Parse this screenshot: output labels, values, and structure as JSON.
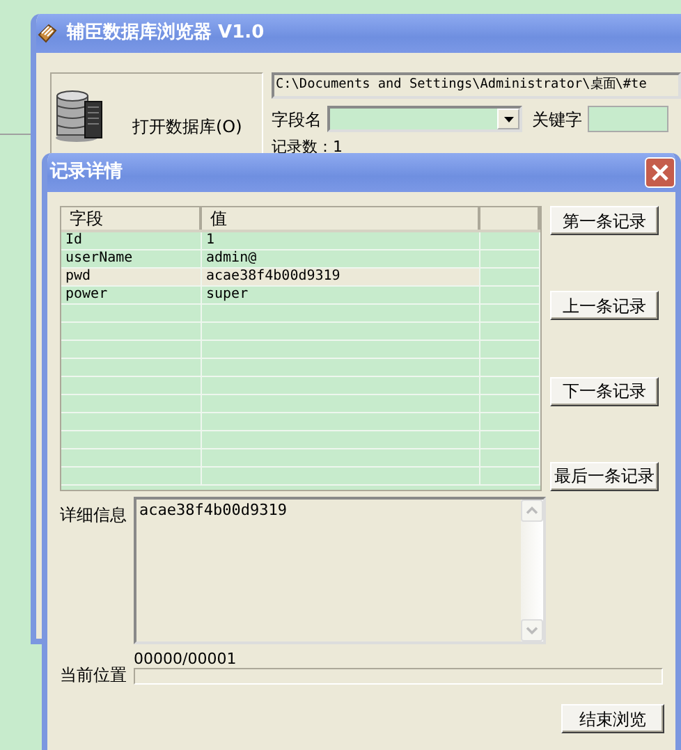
{
  "main_window": {
    "title": "辅臣数据库浏览器 V1.0",
    "open_button": "打开数据库(O)",
    "path": "C:\\Documents and Settings\\Administrator\\桌面\\#te",
    "field_label": "字段名",
    "keyword_label": "关键字",
    "record_count": "记录数：1"
  },
  "dialog": {
    "title": "记录详情",
    "table": {
      "columns": [
        "字段",
        "值"
      ],
      "rows": [
        {
          "field": "Id",
          "value": "1",
          "selected": false
        },
        {
          "field": "userName",
          "value": "admin@",
          "selected": false
        },
        {
          "field": "pwd",
          "value": "acae38f4b00d9319",
          "selected": true
        },
        {
          "field": "power",
          "value": "super",
          "selected": false
        }
      ]
    },
    "nav_buttons": [
      "第一条记录",
      "上一条记录",
      "下一条记录",
      "最后一条记录"
    ],
    "detail_label": "详细信息",
    "detail_text": "acae38f4b00d9319",
    "position_label": "当前位置",
    "position": "00000/00001",
    "progress": {
      "level": 0
    },
    "finish_button": "结束浏览"
  }
}
